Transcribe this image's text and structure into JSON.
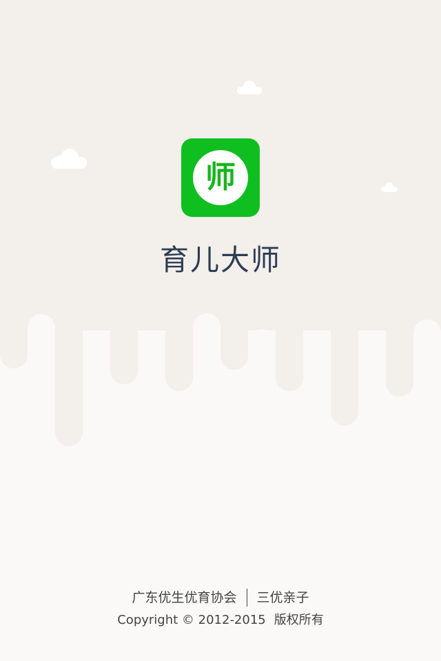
{
  "app": {
    "title": "育儿大师",
    "logo_char": "师"
  },
  "footer": {
    "org1": "广东优生优育协会",
    "org2": "三优亲子",
    "copyright": "Copyright © 2012-2015",
    "rights": "版权所有"
  },
  "colors": {
    "top_background": "#f3efea",
    "bottom_background": "#faf9f7",
    "logo_green": "#0fbf1f",
    "title_color": "#2d3d55",
    "cloud": "#ffffff"
  }
}
